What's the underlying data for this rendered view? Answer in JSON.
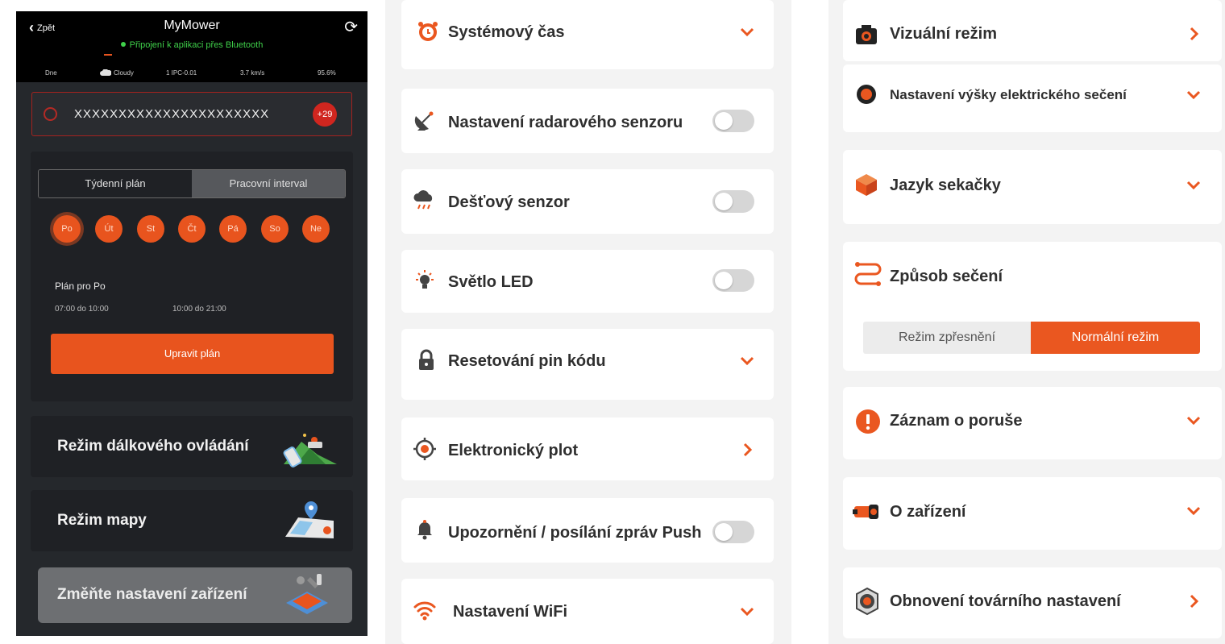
{
  "colors": {
    "accent": "#ea5720",
    "dark_bg": "#25282c",
    "connected": "#3fd04a",
    "alert_red": "#d0261f"
  },
  "phone": {
    "back_label": "Zpět",
    "title": "MyMower",
    "connection_status": "Připojení k aplikaci přes Bluetooth",
    "stats": [
      "Dne",
      "Cloudy",
      "1 IPC-0.01",
      "3.7 km/s",
      "95.6%"
    ],
    "alert": {
      "code": "XXXXXXXXXXXXXXXXXXXXXX",
      "badge": "+29"
    },
    "plan_tabs": {
      "weekly": "Týdenní plán",
      "interval": "Pracovní interval"
    },
    "days": [
      "Po",
      "Út",
      "St",
      "Čt",
      "Pá",
      "So",
      "Ne"
    ],
    "selected_day": "Po",
    "plan_for": "Plán pro Po",
    "slots": [
      "07:00 do 10:00",
      "10:00 do 21:00"
    ],
    "edit_plan": "Upravit plán",
    "remote_mode": "Režim dálkového ovládání",
    "map_mode": "Režim mapy",
    "change_settings": "Změňte nastavení zařízení"
  },
  "middle": {
    "system_time": "Systémový čas",
    "radar_sensor": "Nastavení radarového senzoru",
    "rain_sensor": "Dešťový senzor",
    "led_light": "Světlo LED",
    "pin_reset": "Resetování pin kódu",
    "electronic_fence": "Elektronický plot",
    "push_notifications": "Upozornění / posílání zpráv Push",
    "wifi": "Nastavení WiFi"
  },
  "right": {
    "visual_mode": "Vizuální režim",
    "cut_height": "Nastavení výšky elektrického sečení",
    "language": "Jazyk sekačky",
    "mowing_method": "Způsob sečení",
    "mode_precise": "Režim zpřesnění",
    "mode_normal": "Normální režim",
    "fault_record": "Záznam o poruše",
    "about_device": "O zařízení",
    "factory_reset": "Obnovení továrního nastavení"
  }
}
